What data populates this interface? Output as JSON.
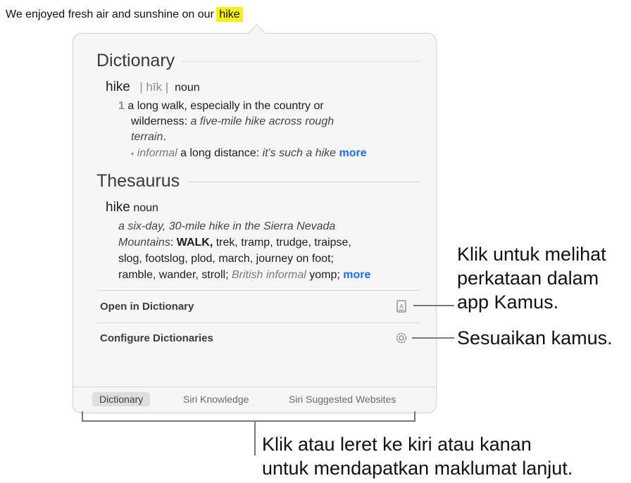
{
  "sentence": {
    "text": "We enjoyed fresh air and sunshine on our",
    "highlight": "hike"
  },
  "dictionary": {
    "heading": "Dictionary",
    "headword": "hike",
    "pronunciation": "| hīk |",
    "pos": "noun",
    "sense_number": "1",
    "def_part1": "a long walk, especially in the country or",
    "def_part2": "wilderness:",
    "example_part1": "a five-mile hike across rough",
    "example_part2": "terrain",
    "period": ".",
    "sub_label": "informal",
    "sub_def": "a long distance:",
    "sub_example": "it's such a hike",
    "more": "more"
  },
  "thesaurus": {
    "heading": "Thesaurus",
    "headword": "hike",
    "pos": "noun",
    "example_line1": "a six-day, 30-mile hike in the Sierra Nevada",
    "example_line2": "Mountains",
    "colon": ":",
    "first_syn": "WALK,",
    "syn_line1_rest": "trek, tramp, trudge, traipse,",
    "syn_line2": "slog, footslog, plod, march, journey on foot;",
    "syn_line3": "ramble, wander, stroll;",
    "register_label": "British informal",
    "extra_syn": "yomp;",
    "more": "more"
  },
  "actions": {
    "open_dictionary": "Open in Dictionary",
    "configure": "Configure Dictionaries"
  },
  "tabs": [
    "Dictionary",
    "Siri Knowledge",
    "Siri Suggested Websites"
  ],
  "selected_tab": "Dictionary",
  "callouts": {
    "open_app": [
      "Klik untuk melihat",
      "perkataan dalam",
      "app Kamus."
    ],
    "configure": "Sesuaikan kamus.",
    "swipe": [
      "Klik atau leret ke kiri atau kanan",
      "untuk mendapatkan maklumat lanjut."
    ]
  },
  "icons": {
    "dictionary_book": "book-icon",
    "settings": "gear-icon"
  },
  "colors": {
    "highlight": "#f7ef1a",
    "link": "#1a6ee8",
    "popover_bg": "#f6f6f6"
  }
}
